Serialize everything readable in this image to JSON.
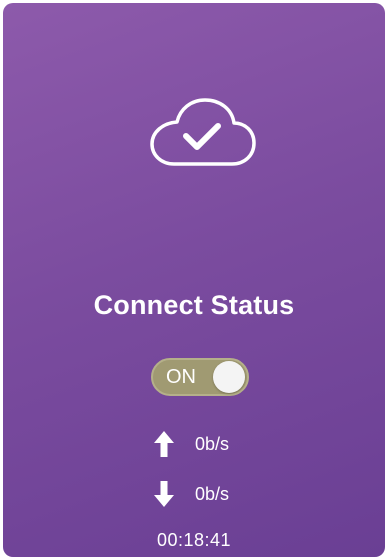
{
  "status_card": {
    "icon": "cloud-check-icon",
    "title": "Connect Status",
    "toggle": {
      "label": "ON",
      "state": "on"
    },
    "upload": {
      "icon": "arrow-up-icon",
      "rate": "0b/s"
    },
    "download": {
      "icon": "arrow-down-icon",
      "rate": "0b/s"
    },
    "elapsed": "00:18:41"
  },
  "colors": {
    "card_gradient_start": "#8d5aab",
    "card_gradient_end": "#6a3f94",
    "toggle_track": "#a09a72",
    "text": "#ffffff"
  }
}
